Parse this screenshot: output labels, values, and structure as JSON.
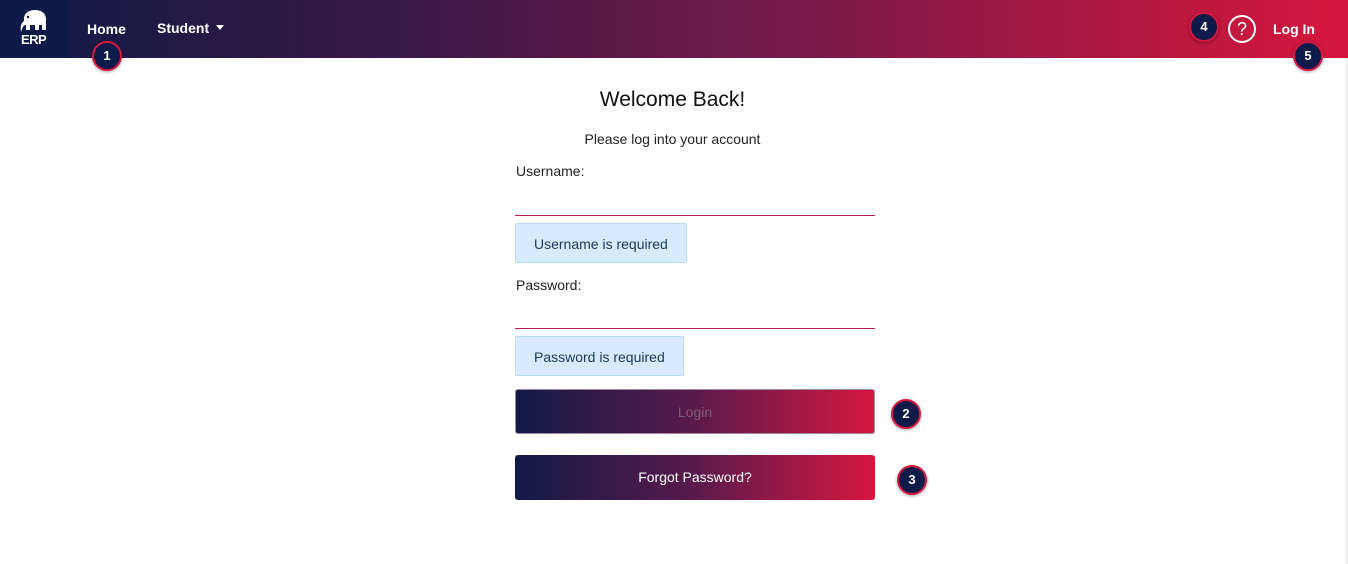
{
  "nav": {
    "logo_text": "ERP",
    "home": "Home",
    "student": "Student",
    "help_glyph": "?",
    "login": "Log In"
  },
  "badges": {
    "b1": "1",
    "b2": "2",
    "b3": "3",
    "b4": "4",
    "b5": "5"
  },
  "form": {
    "title": "Welcome Back!",
    "subtitle": "Please log into your account",
    "username_label": "Username:",
    "username_value": "",
    "username_error": "Username is required",
    "password_label": "Password:",
    "password_value": "",
    "password_error": "Password is required",
    "login_button": "Login",
    "forgot_button": "Forgot Password?"
  },
  "colors": {
    "nav_start": "#0f1a45",
    "nav_end": "#d6173f",
    "accent": "#b0205a",
    "error_bg": "#d6ebff"
  },
  "icons": {
    "logo": "elephant-icon",
    "help": "question-circle-icon",
    "dropdown": "caret-down-icon"
  }
}
